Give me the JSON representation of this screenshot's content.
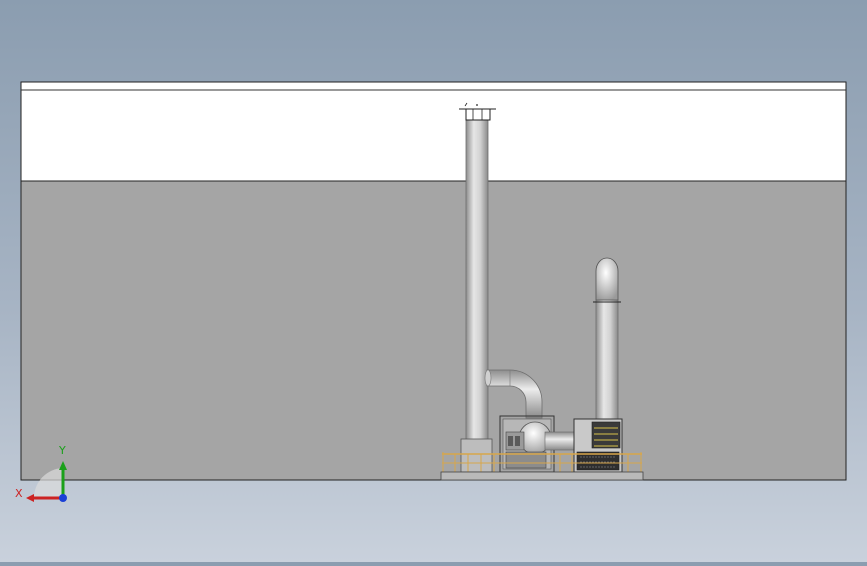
{
  "view": {
    "background_top": "#8b9db0",
    "background_bottom": "#c9d1dc",
    "wall_upper_color": "#ffffff",
    "wall_lower_color": "#a5a5a5",
    "stack_color": "#c4c4c4",
    "railing_color": "#d8a64a"
  },
  "triad": {
    "x_label": "X",
    "y_label": "Y",
    "x_color": "#cc2222",
    "y_color": "#1aa01a",
    "z_color": "#1a3fd6"
  }
}
